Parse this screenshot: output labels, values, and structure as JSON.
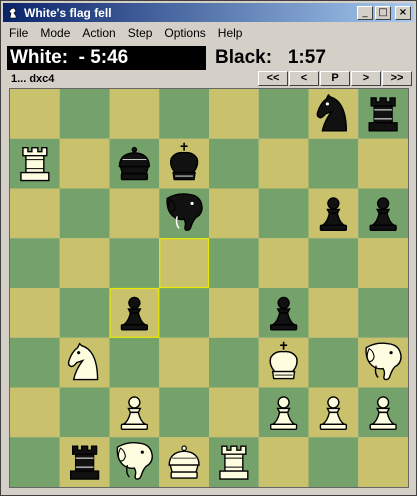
{
  "window": {
    "title": "White's flag fell",
    "minimize_glyph": "_",
    "maximize_glyph": "□",
    "close_glyph": "×"
  },
  "menu": [
    "File",
    "Mode",
    "Action",
    "Step",
    "Options",
    "Help"
  ],
  "clocks": {
    "white": "White:  - 5:46",
    "black": "Black:   1:57"
  },
  "move_text": "1... dxc4",
  "nav_buttons": [
    "<<",
    "<",
    "P",
    ">",
    ">>"
  ],
  "colors": {
    "light_square": "#c9c16c",
    "dark_square": "#75a16a",
    "highlight": "#e8e800",
    "white_piece": "#fffde0",
    "black_piece": "#111111"
  },
  "board": {
    "files": [
      "a",
      "b",
      "c",
      "d",
      "e",
      "f",
      "g",
      "h"
    ],
    "highlight_squares": [
      "c4",
      "d5"
    ],
    "pieces": [
      {
        "square": "g8",
        "color": "black",
        "type": "knight"
      },
      {
        "square": "h8",
        "color": "black",
        "type": "rook"
      },
      {
        "square": "a7",
        "color": "white",
        "type": "rook"
      },
      {
        "square": "c7",
        "color": "black",
        "type": "crowned-piece"
      },
      {
        "square": "d7",
        "color": "black",
        "type": "king"
      },
      {
        "square": "d6",
        "color": "black",
        "type": "elephant"
      },
      {
        "square": "g6",
        "color": "black",
        "type": "pawn"
      },
      {
        "square": "h6",
        "color": "black",
        "type": "pawn"
      },
      {
        "square": "c4",
        "color": "black",
        "type": "pawn"
      },
      {
        "square": "f4",
        "color": "black",
        "type": "pawn"
      },
      {
        "square": "b3",
        "color": "white",
        "type": "knight"
      },
      {
        "square": "f3",
        "color": "white",
        "type": "king"
      },
      {
        "square": "h3",
        "color": "white",
        "type": "elephant"
      },
      {
        "square": "c2",
        "color": "white",
        "type": "pawn"
      },
      {
        "square": "f2",
        "color": "white",
        "type": "pawn"
      },
      {
        "square": "g2",
        "color": "white",
        "type": "pawn"
      },
      {
        "square": "h2",
        "color": "white",
        "type": "pawn"
      },
      {
        "square": "b1",
        "color": "black",
        "type": "rook"
      },
      {
        "square": "c1",
        "color": "white",
        "type": "elephant"
      },
      {
        "square": "d1",
        "color": "white",
        "type": "crowned-piece"
      },
      {
        "square": "e1",
        "color": "white",
        "type": "rook"
      }
    ]
  }
}
